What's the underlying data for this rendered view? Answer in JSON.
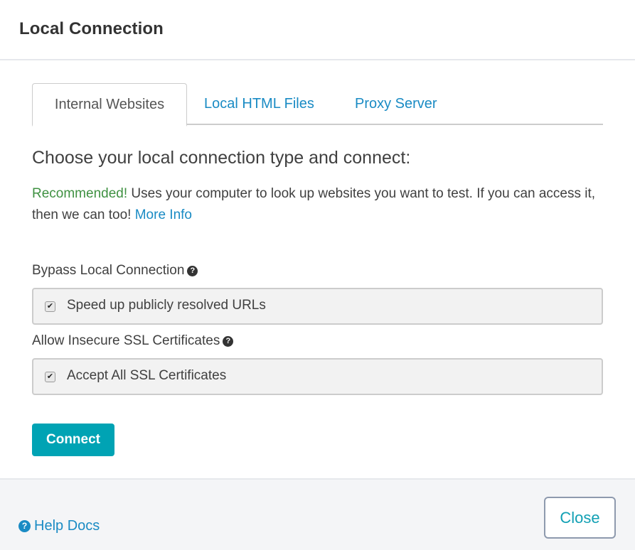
{
  "header": {
    "title": "Local Connection"
  },
  "tabs": [
    {
      "label": "Internal Websites",
      "active": true
    },
    {
      "label": "Local HTML Files",
      "active": false
    },
    {
      "label": "Proxy Server",
      "active": false
    }
  ],
  "content": {
    "heading": "Choose your local connection type and connect:",
    "recommended": "Recommended!",
    "description": " Uses your computer to look up websites you want to test. If you can access it, then we can too! ",
    "more_info": "More Info"
  },
  "options": [
    {
      "label": "Bypass Local Connection",
      "help_icon": "question-circle-icon",
      "checkbox_label": "Speed up publicly resolved URLs",
      "checked": true
    },
    {
      "label": "Allow Insecure SSL Certificates",
      "help_icon": "question-circle-icon",
      "checkbox_label": "Accept All SSL Certificates",
      "checked": true
    }
  ],
  "actions": {
    "connect": "Connect"
  },
  "footer": {
    "help_docs": "Help Docs",
    "close": "Close"
  },
  "glyphs": {
    "help": "?",
    "check": "✔"
  },
  "colors": {
    "accent": "#00a3b4",
    "link": "#1a8bc4",
    "recommended": "#3f9142"
  }
}
